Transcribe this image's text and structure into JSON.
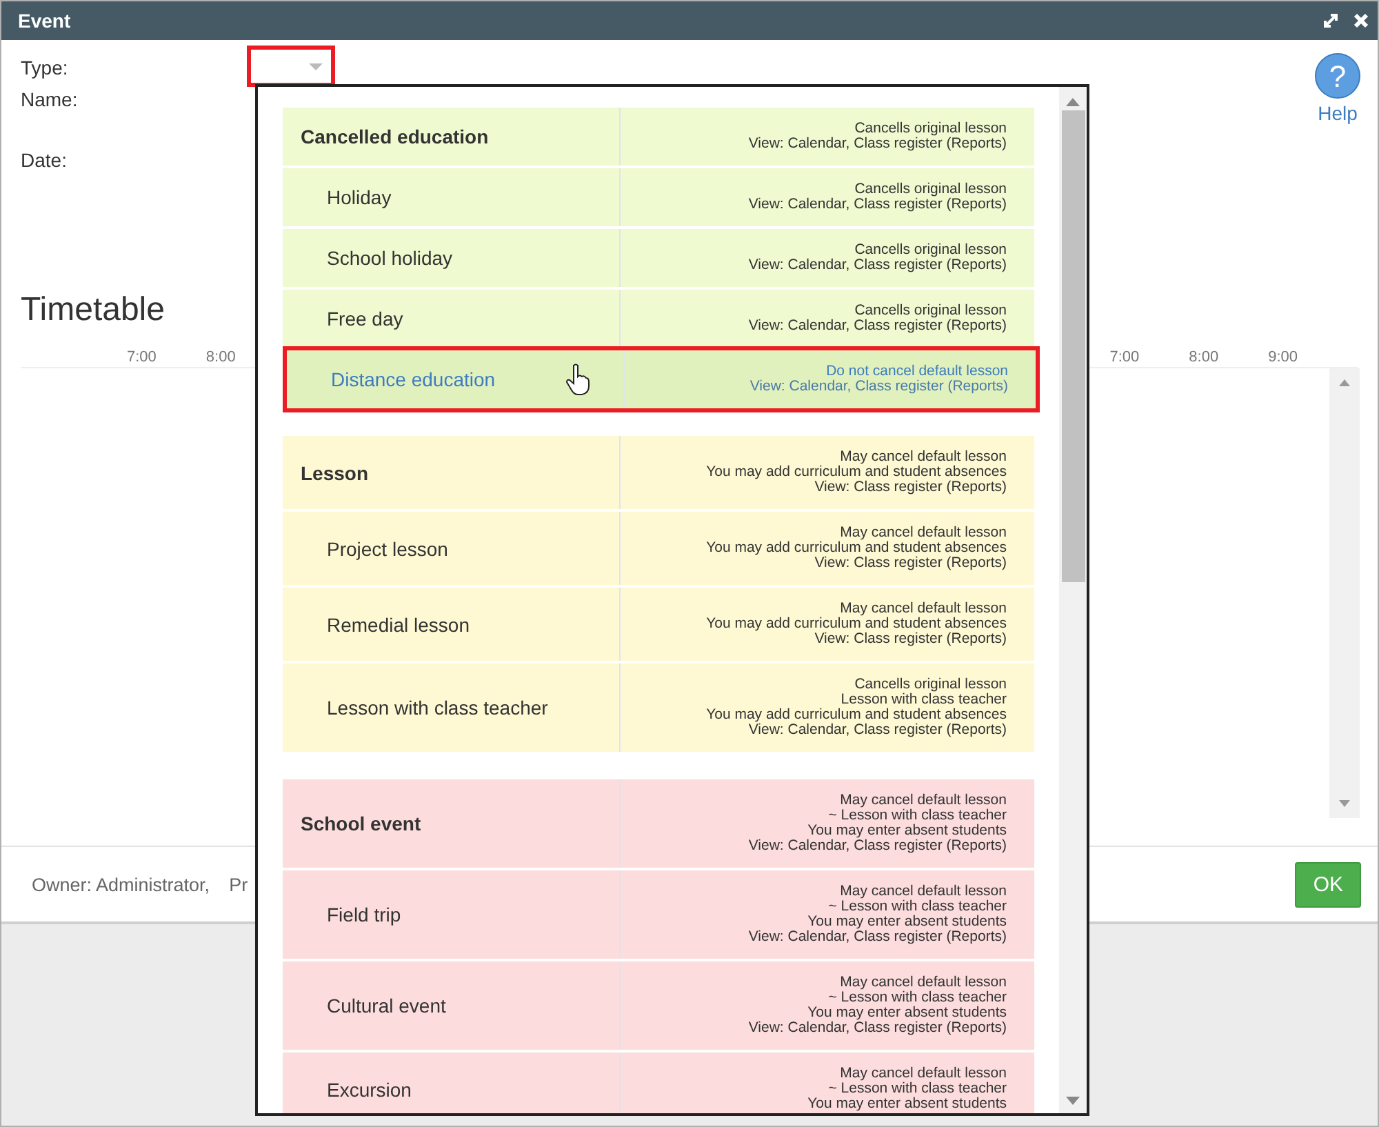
{
  "window": {
    "title": "Event"
  },
  "form": {
    "fields": [
      {
        "label": "Type:",
        "kind": "select",
        "highlighted": true
      },
      {
        "label": "Name:",
        "kind": "text"
      },
      {
        "label": "Date:",
        "kind": "date"
      }
    ]
  },
  "help": {
    "icon_text": "?",
    "label": "Help"
  },
  "timetable": {
    "title": "Timetable",
    "left_ticks": [
      "7:00",
      "8:00"
    ],
    "right_ticks": [
      "7:00",
      "8:00",
      "9:00"
    ]
  },
  "footer": {
    "owner": "Owner: Administrator,",
    "cut_text": "Pr",
    "ok": "OK"
  },
  "dropdown": {
    "groups": [
      {
        "color": "#effad0",
        "label": "Cancelled education",
        "notes": [
          "Cancells original lesson",
          "View: Calendar, Class register (Reports)"
        ],
        "items": [
          {
            "label": "Holiday",
            "selected": false,
            "notes": [
              "Cancells original lesson",
              "View: Calendar, Class register (Reports)"
            ]
          },
          {
            "label": "School holiday",
            "selected": false,
            "notes": [
              "Cancells original lesson",
              "View: Calendar, Class register (Reports)"
            ]
          },
          {
            "label": "Free day",
            "selected": false,
            "notes": [
              "Cancells original lesson",
              "View: Calendar, Class register (Reports)"
            ]
          },
          {
            "label": "Distance education",
            "selected": true,
            "notes": [
              "Do not cancel default lesson",
              "View: Calendar, Class register (Reports)"
            ]
          }
        ]
      },
      {
        "color": "#fef9d3",
        "label": "Lesson",
        "notes": [
          "May cancel default lesson",
          "You may add curriculum and student absences",
          "View: Class register (Reports)"
        ],
        "items": [
          {
            "label": "Project lesson",
            "selected": false,
            "notes": [
              "May cancel default lesson",
              "You may add curriculum and student absences",
              "View: Class register (Reports)"
            ]
          },
          {
            "label": "Remedial lesson",
            "selected": false,
            "notes": [
              "May cancel default lesson",
              "You may add curriculum and student absences",
              "View: Class register (Reports)"
            ]
          },
          {
            "label": "Lesson with class teacher",
            "selected": false,
            "notes": [
              "Cancells original lesson",
              "Lesson with class teacher",
              "You may add curriculum and student absences",
              "View: Calendar, Class register (Reports)"
            ]
          }
        ]
      },
      {
        "color": "#fcdcdc",
        "label": "School event",
        "notes": [
          "May cancel default lesson",
          "~ Lesson with class teacher",
          "You may enter absent students",
          "View: Calendar, Class register (Reports)"
        ],
        "items": [
          {
            "label": "Field trip",
            "selected": false,
            "notes": [
              "May cancel default lesson",
              "~ Lesson with class teacher",
              "You may enter absent students",
              "View: Calendar, Class register (Reports)"
            ]
          },
          {
            "label": "Cultural event",
            "selected": false,
            "notes": [
              "May cancel default lesson",
              "~ Lesson with class teacher",
              "You may enter absent students",
              "View: Calendar, Class register (Reports)"
            ]
          },
          {
            "label": "Excursion",
            "selected": false,
            "notes": [
              "May cancel default lesson",
              "~ Lesson with class teacher",
              "You may enter absent students"
            ]
          }
        ]
      }
    ]
  }
}
